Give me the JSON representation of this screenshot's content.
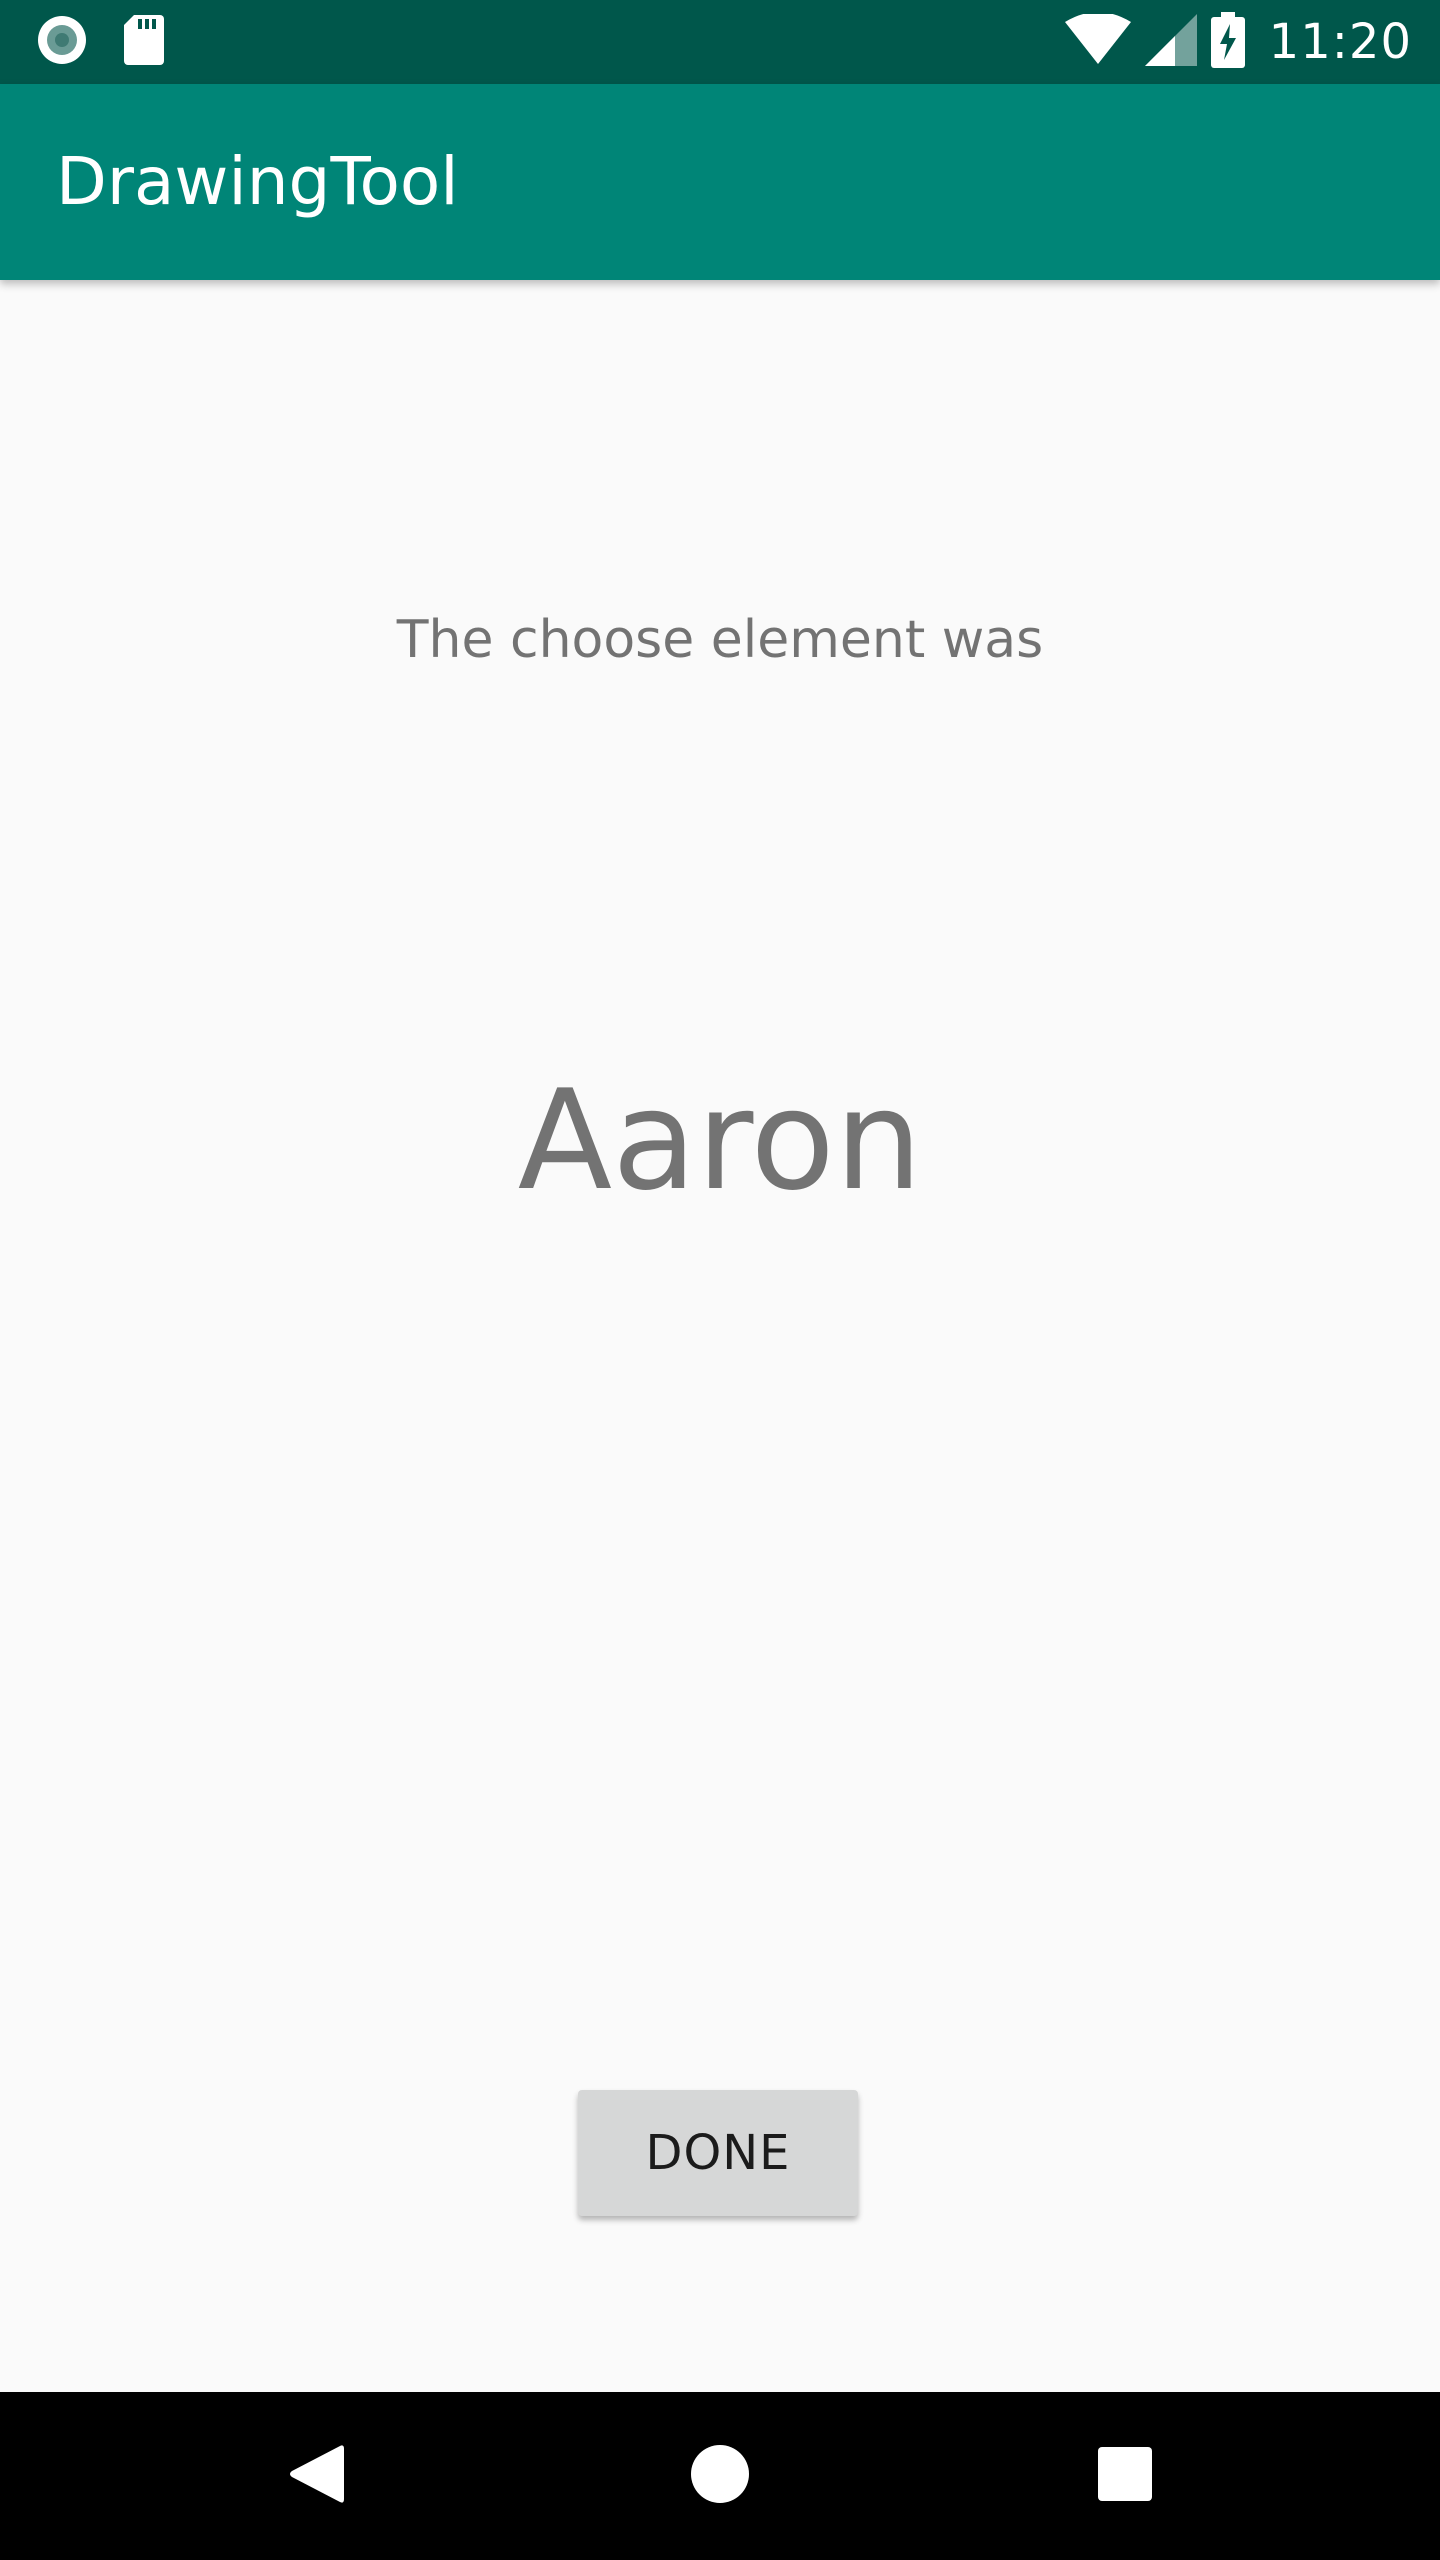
{
  "status_bar": {
    "time": "11:20",
    "icons": [
      "record-icon",
      "sd-card-icon",
      "wifi-icon",
      "signal-icon",
      "battery-charging-icon"
    ],
    "background": "#00574b"
  },
  "app_bar": {
    "title": "DrawingTool",
    "background": "#008577"
  },
  "main": {
    "prompt": "The choose element was",
    "result": "Aaron",
    "done_label": "DONE"
  },
  "nav_bar": {
    "icons": [
      "back-icon",
      "home-icon",
      "recents-icon"
    ]
  }
}
